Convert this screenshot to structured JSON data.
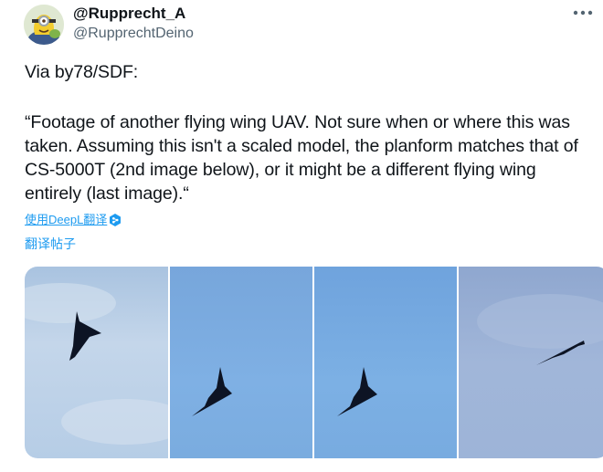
{
  "author": {
    "display_name": "@Rupprecht_A",
    "handle": "@RupprechtDeino",
    "avatar_icon": "minion-avatar"
  },
  "tweet": {
    "lines": [
      "Via by78/SDF:",
      "“Footage of another flying wing UAV. Not sure when or where this was",
      "taken. Assuming this isn't a scaled model, the planform matches that of",
      "CS-5000T (2nd image below), or it might be a different flying wing",
      "entirely (last image).“"
    ]
  },
  "translation": {
    "deepl_label": "使用DeepL翻译",
    "translate_post_label": "翻译帖子",
    "deepl_icon": "deepl-logo",
    "link_color": "#1d9bf0"
  },
  "media": {
    "count": 4,
    "icons": [
      "flying-wing-uav",
      "flying-wing-uav",
      "flying-wing-uav",
      "flying-wing-uav"
    ]
  },
  "colors": {
    "text": "#0f1419",
    "secondary_text": "#536471",
    "accent": "#1d9bf0"
  }
}
